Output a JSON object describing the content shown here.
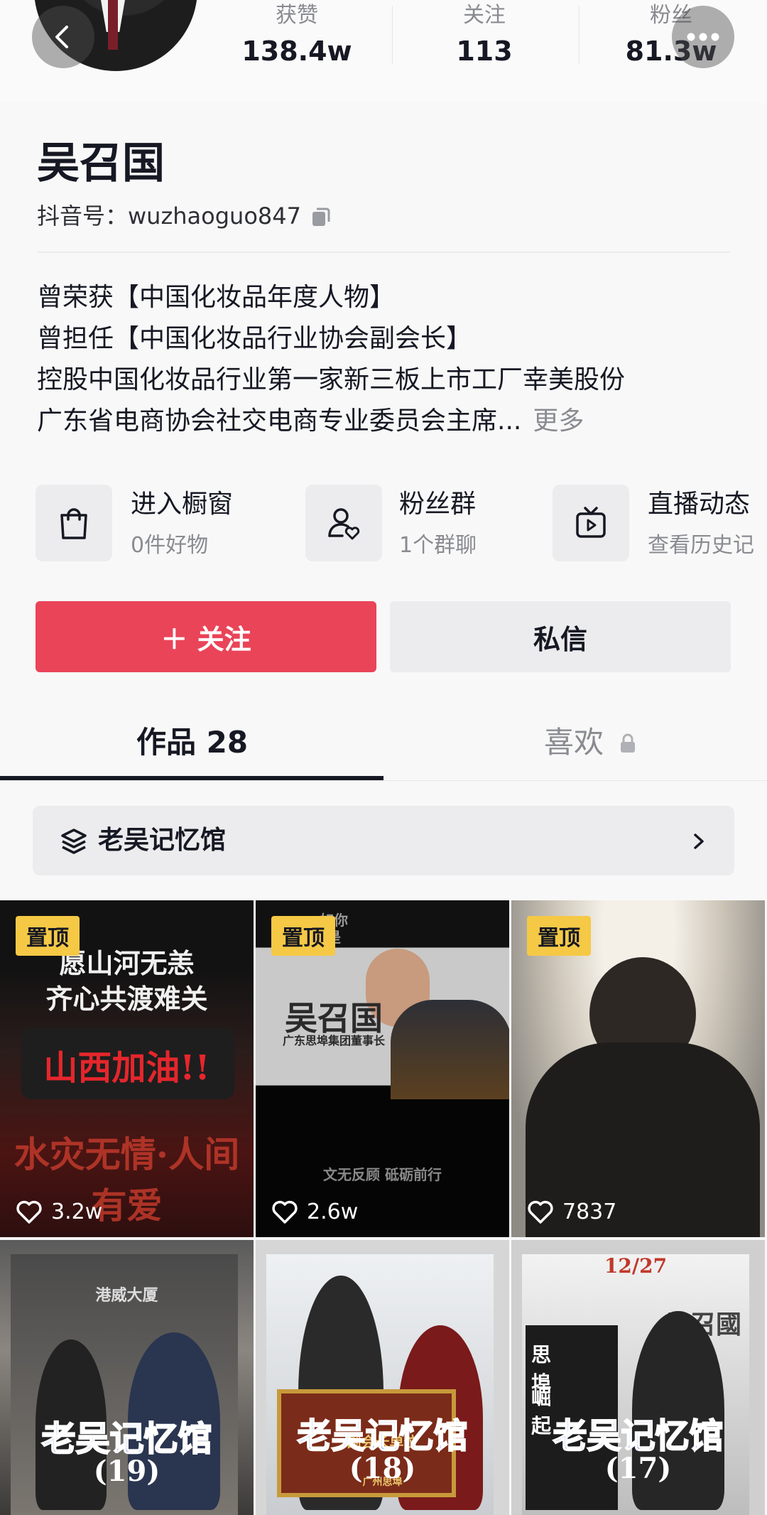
{
  "header": {
    "stats": [
      {
        "label": "获赞",
        "value": "138.4w"
      },
      {
        "label": "关注",
        "value": "113"
      },
      {
        "label": "粉丝",
        "value": "81.3w"
      }
    ]
  },
  "profile": {
    "name": "吴召国",
    "douyin_id": "抖音号：wuzhaoguo847",
    "bio": [
      "曾荣获【中国化妆品年度人物】",
      "曾担任【中国化妆品行业协会副会长】",
      "控股中国化妆品行业第一家新三板上市工厂幸美股份",
      "广东省电商协会社交电商专业委员会主席..."
    ],
    "bio_more": "更多"
  },
  "shortcuts": [
    {
      "title": "进入橱窗",
      "subtitle": "0件好物",
      "icon": "shopping-bag-icon"
    },
    {
      "title": "粉丝群",
      "subtitle": "1个群聊",
      "icon": "fan-group-icon"
    },
    {
      "title": "直播动态",
      "subtitle": "查看历史记",
      "icon": "live-tv-icon"
    }
  ],
  "actions": {
    "follow": "＋ 关注",
    "message": "私信"
  },
  "tabs": [
    {
      "label": "作品 28",
      "active": true
    },
    {
      "label": "喜欢",
      "active": false,
      "locked": true
    }
  ],
  "collection": {
    "label": "老吴记忆馆"
  },
  "videos": [
    {
      "pinned": "置顶",
      "likes": "3.2w",
      "lines": [
        "愿山河无恙",
        "齐心共渡难关",
        "山西加油!!",
        "水灾无情·人间有爱"
      ]
    },
    {
      "pinned": "置顶",
      "likes": "2.6w",
      "lines": [
        "吴召国",
        "广东思埠集团董事长",
        "如你",
        "是",
        "文无反顾 砥砺前行"
      ]
    },
    {
      "pinned": "置顶",
      "likes": "7837",
      "lines": []
    },
    {
      "banner": "老吴记忆馆",
      "count": "(19)",
      "lines": [
        "港威大厦"
      ]
    },
    {
      "banner": "老吴记忆馆",
      "count": "(18)",
      "lines": [
        "副会长单位",
        "广州思埠"
      ]
    },
    {
      "banner": "老吴记忆馆",
      "count": "(17)",
      "lines": [
        "12/27",
        "吴召國",
        "思埠",
        "崛起"
      ]
    }
  ],
  "colors": {
    "accent": "#ea4459",
    "pin": "#f5c945",
    "text": "#161823",
    "muted": "#8a8b91"
  }
}
